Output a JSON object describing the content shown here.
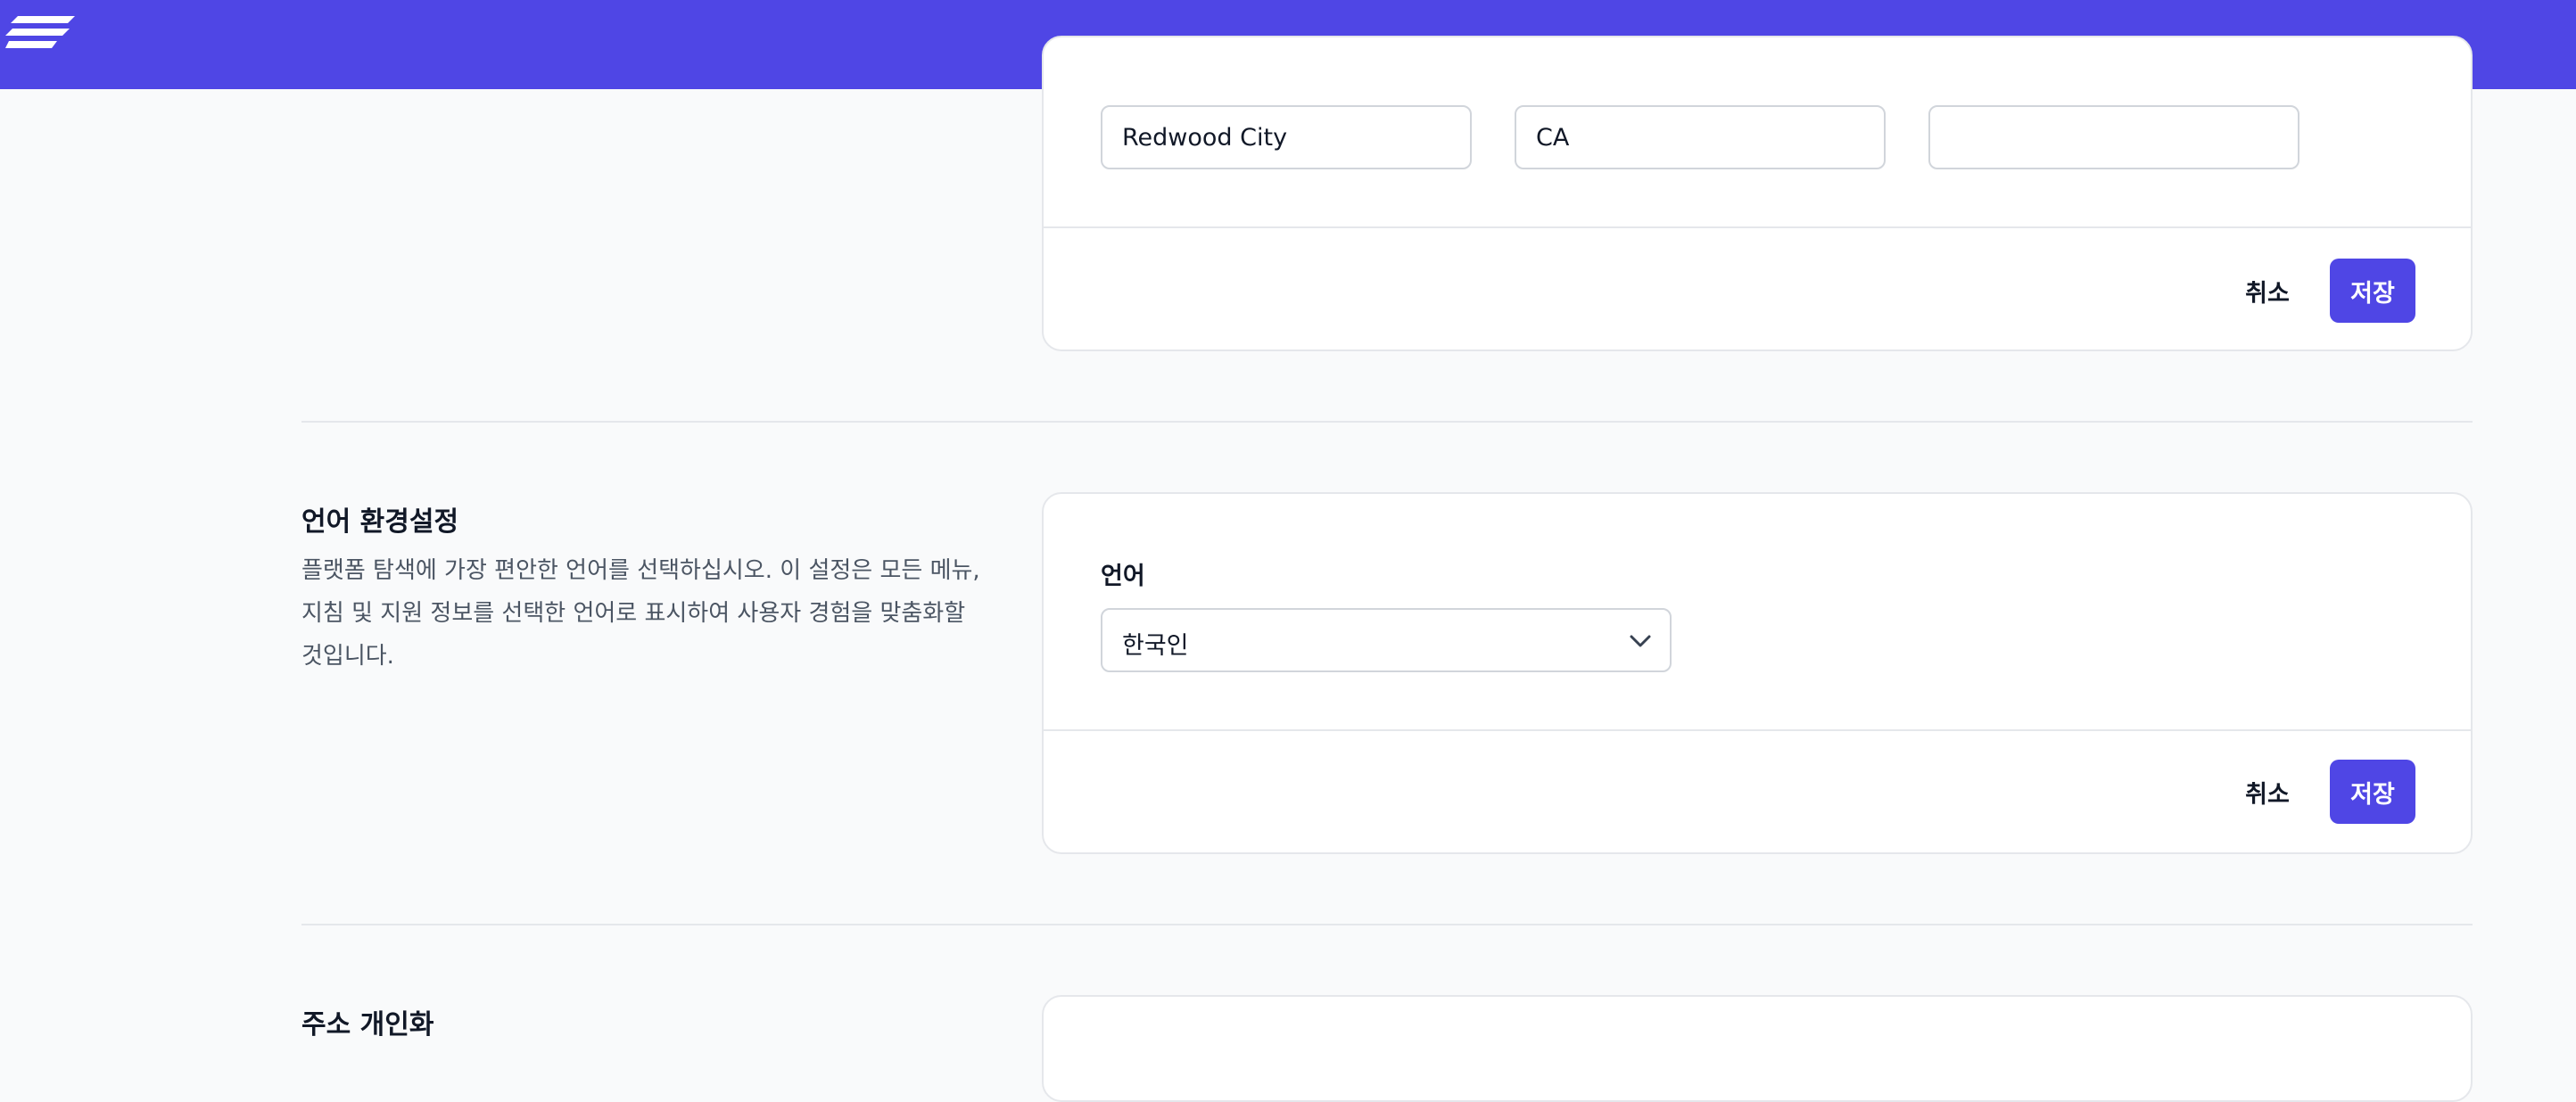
{
  "header": {
    "logo_icon": "stacked-stripes-logo-icon",
    "brand_color": "#4f46e5"
  },
  "address_card": {
    "city_value": "Redwood City",
    "state_value": "CA",
    "zip_value": "",
    "cancel_label": "취소",
    "save_label": "저장"
  },
  "language_section": {
    "title": "언어 환경설정",
    "description": "플랫폼 탐색에 가장 편안한 언어를 선택하십시오. 이 설정은 모든 메뉴, 지침 및 지원 정보를 선택한 언어로 표시하여 사용자 경험을 맞춤화할 것입니다.",
    "field_label": "언어",
    "selected_language": "한국인",
    "select_icon": "chevron-down-icon",
    "cancel_label": "취소",
    "save_label": "저장"
  },
  "next_section": {
    "title": "주소 개인화"
  }
}
